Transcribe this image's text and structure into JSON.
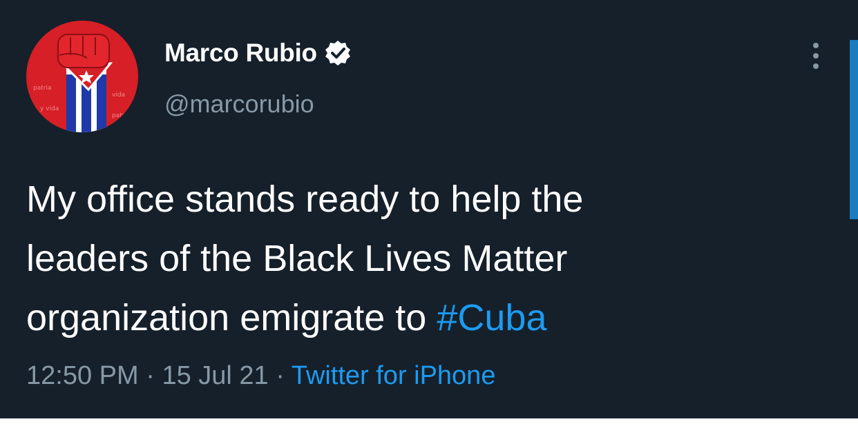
{
  "tweet": {
    "author": {
      "display_name": "Marco Rubio",
      "handle": "@marcorubio",
      "verified": true,
      "avatar_icon": "raised-fist-cuban-flag"
    },
    "text_main": "My office stands ready to help the\nleaders of the Black Lives Matter\norganization emigrate to ",
    "hashtag": "#Cuba",
    "time": "12:50 PM",
    "date": "15 Jul 21",
    "separator": " · ",
    "source": "Twitter for iPhone"
  },
  "colors": {
    "background": "#15202b",
    "text": "#ffffff",
    "secondary": "#8899a6",
    "accent": "#1d9bf0",
    "avatar_red": "#d61f26"
  },
  "icons": {
    "more": "more-vertical-icon",
    "verified": "verified-badge-icon"
  }
}
